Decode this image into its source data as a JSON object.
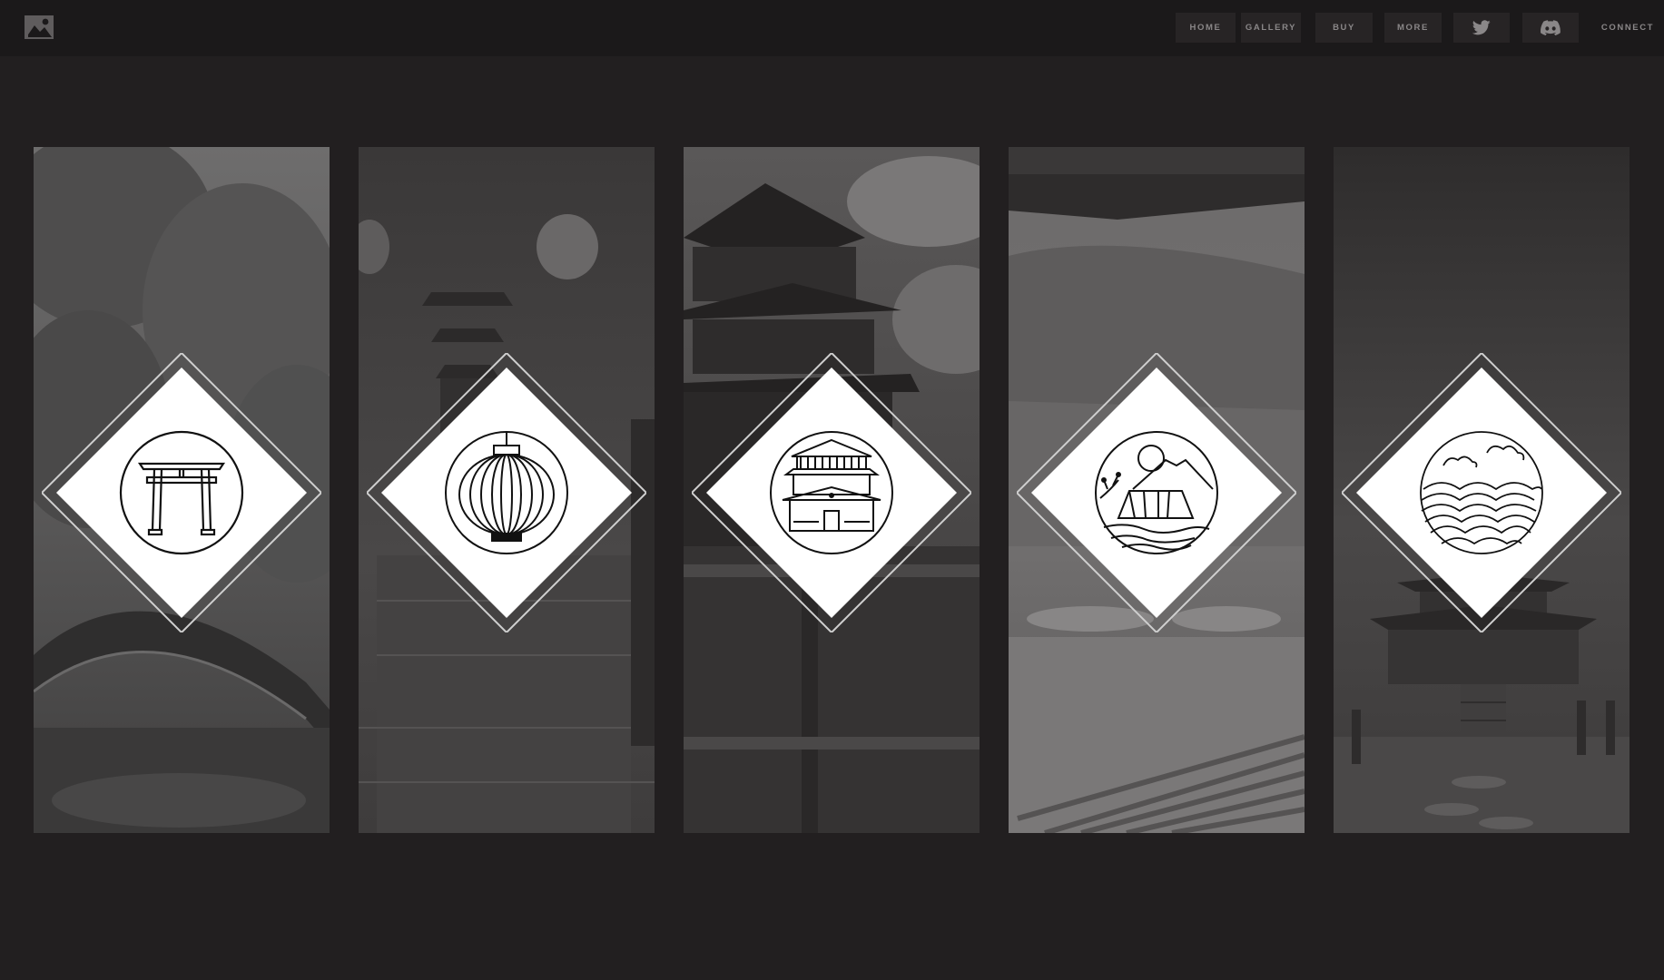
{
  "header": {
    "logo_icon": "image-gallery-logo-icon",
    "nav": [
      {
        "label": "HOME"
      },
      {
        "label": "GALLERY"
      },
      {
        "label": "BUY"
      },
      {
        "label": "MORE"
      },
      {
        "icon": "twitter-icon"
      },
      {
        "icon": "discord-icon"
      },
      {
        "label": "CONNECT"
      }
    ]
  },
  "colors": {
    "page_background": "#221f20",
    "header_background": "#1b191a",
    "nav_button_background": "#272425",
    "nav_text": "#8a8788",
    "emblem_fill": "#ffffff",
    "emblem_line": "#111111"
  },
  "panels": [
    {
      "scene": "garden-bridge",
      "icon": "torii-gate-icon"
    },
    {
      "scene": "lantern-street",
      "icon": "paper-lantern-icon"
    },
    {
      "scene": "pagoda-night",
      "icon": "temple-building-icon"
    },
    {
      "scene": "misty-lake",
      "icon": "mountain-house-icon"
    },
    {
      "scene": "water-pavilion",
      "icon": "waves-clouds-icon"
    }
  ]
}
